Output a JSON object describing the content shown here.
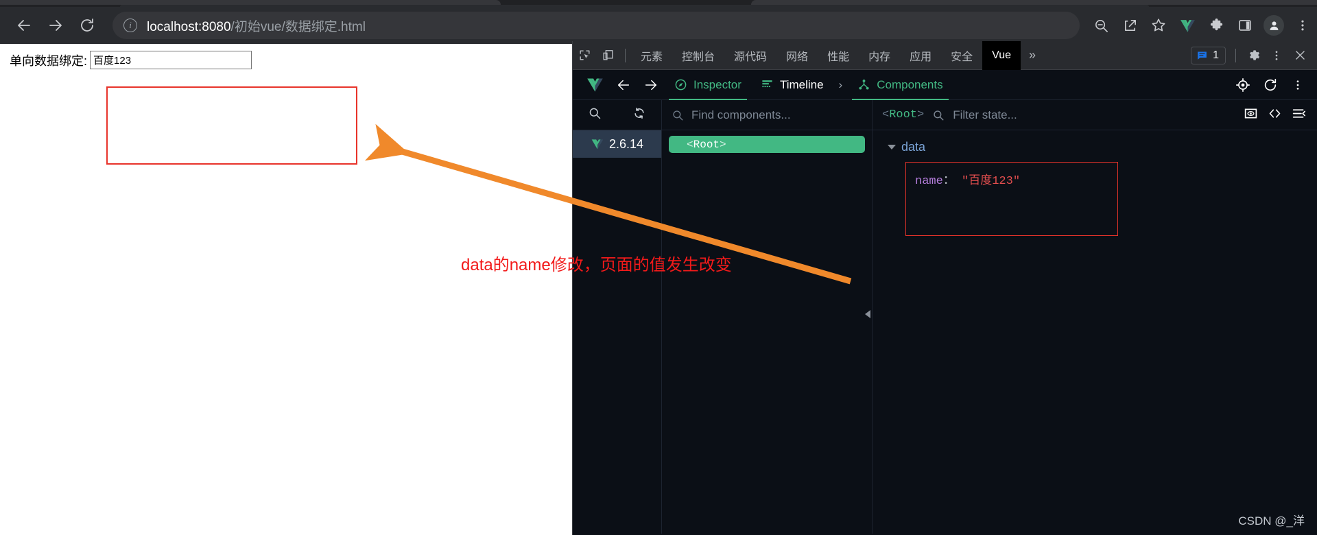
{
  "browser": {
    "nav": {
      "back_icon": "arrow-left-icon",
      "forward_icon": "arrow-right-icon",
      "reload_icon": "reload-icon"
    },
    "omnibox": {
      "info_icon": "info-circle-icon",
      "host": "localhost:8080",
      "path": "/初始vue/数据绑定.html",
      "full_url": "localhost:8080/初始vue/数据绑定.html"
    },
    "toolbar_icons": [
      "zoom-out-icon",
      "share-icon",
      "bookmark-star-icon",
      "vue-extension-icon",
      "extensions-puzzle-icon",
      "side-panel-icon",
      "profile-avatar-icon",
      "chrome-menu-icon"
    ]
  },
  "page": {
    "label": "单向数据绑定:",
    "input_value": "百度123"
  },
  "devtools": {
    "left_icons": [
      "inspect-element-icon",
      "device-toolbar-icon"
    ],
    "tabs": [
      {
        "label": "元素",
        "active": false
      },
      {
        "label": "控制台",
        "active": false
      },
      {
        "label": "源代码",
        "active": false
      },
      {
        "label": "网络",
        "active": false
      },
      {
        "label": "性能",
        "active": false
      },
      {
        "label": "内存",
        "active": false
      },
      {
        "label": "应用",
        "active": false
      },
      {
        "label": "安全",
        "active": false
      },
      {
        "label": "Vue",
        "active": true
      }
    ],
    "overflow_label": "»",
    "message_count": "1",
    "right_icons": [
      "message-badge-icon",
      "settings-gear-icon",
      "devtools-menu-icon",
      "close-icon"
    ]
  },
  "vue": {
    "logo_icon": "vue-logo-icon",
    "back_icon": "arrow-left-icon",
    "forward_icon": "arrow-right-icon",
    "tabs": [
      {
        "label": "Inspector",
        "icon": "compass-icon",
        "active": true
      },
      {
        "label": "Timeline",
        "icon": "timeline-icon",
        "active": false
      }
    ],
    "chevron": "›",
    "components_tab": {
      "label": "Components",
      "icon": "component-tree-icon"
    },
    "header_icons": [
      "target-crosshair-icon",
      "refresh-icon",
      "vue-menu-icon"
    ],
    "search": {
      "magnifier_icon": "search-icon",
      "refresh_icon": "sync-icon",
      "find_placeholder": "Find components...",
      "filter_placeholder": "Filter state...",
      "root_brackets_open": "<",
      "root_name": "Root",
      "root_brackets_close": ">",
      "right_icons": [
        "inspect-dom-icon",
        "code-brackets-icon",
        "collapse-all-icon"
      ]
    },
    "version": "2.6.14",
    "selected_component": {
      "open": "<",
      "name": "Root",
      "close": ">"
    },
    "state": {
      "group_label": "data",
      "entry_key": "name",
      "entry_colon": "：",
      "entry_quote": "\"",
      "entry_value": "百度123"
    }
  },
  "annotations": {
    "text": "data的name修改，页面的值发生改变",
    "text_color": "#f21a1a",
    "box_color": "#e8332a",
    "arrow_color": "#f0892b"
  },
  "watermark": "CSDN @_洋",
  "colors": {
    "vue_green": "#42b883",
    "devtools_bg": "#0b0f16",
    "chrome_bg": "#292b2f",
    "accent_blue": "#1a73e8"
  }
}
